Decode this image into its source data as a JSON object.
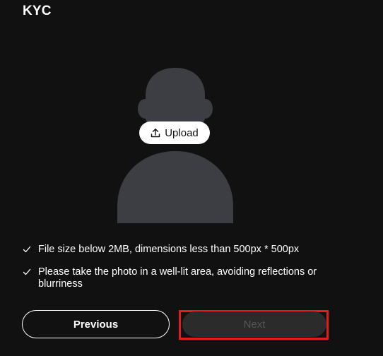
{
  "page": {
    "title": "KYC"
  },
  "upload": {
    "label": "Upload",
    "icon": "upload-icon"
  },
  "requirements": [
    {
      "text": "File size below 2MB, dimensions less than 500px * 500px",
      "icon": "check-icon"
    },
    {
      "text": "Please take the photo in a well-lit area, avoiding reflections or blurriness",
      "icon": "check-icon"
    }
  ],
  "buttons": {
    "previous_label": "Previous",
    "next_label": "Next",
    "next_state": "disabled"
  },
  "colors": {
    "background": "#111111",
    "avatar": "#3d3e44",
    "highlight": "#e31b1b",
    "next_button_bg": "#2b2b2b"
  }
}
